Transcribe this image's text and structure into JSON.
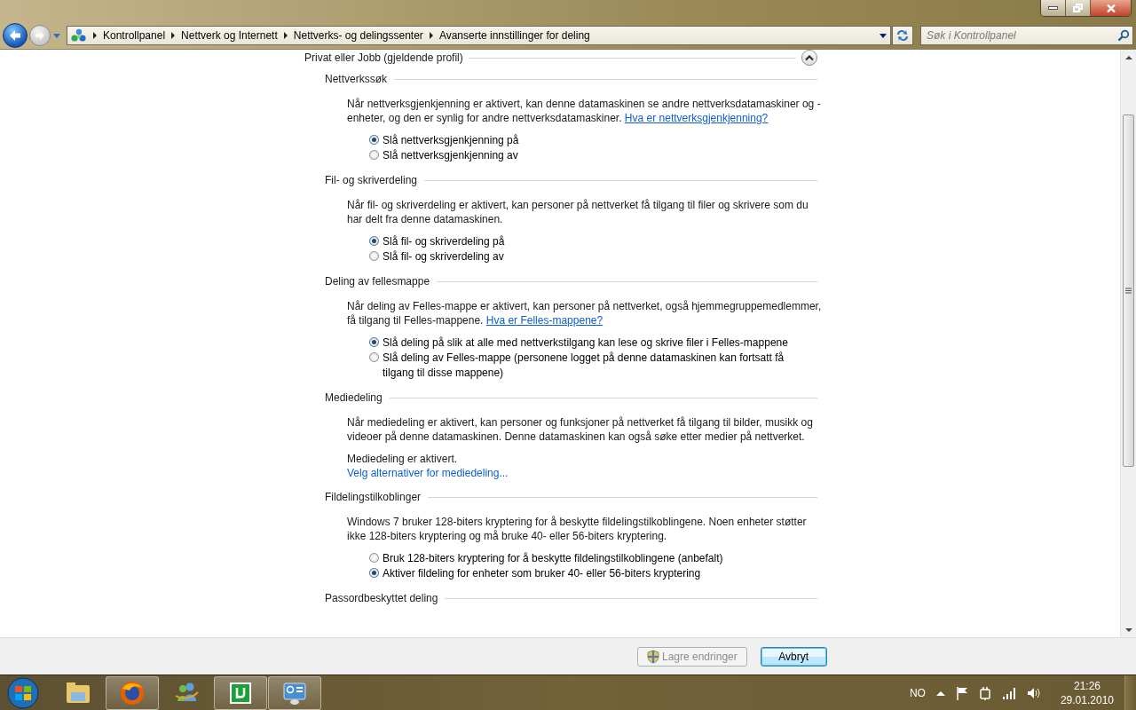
{
  "navigation": {
    "back": {
      "disabled": false
    },
    "forward": {
      "disabled": true
    }
  },
  "address_bar": {
    "breadcrumbs": [
      "Kontrollpanel",
      "Nettverk og Internett",
      "Nettverks- og delingssenter",
      "Avanserte innstillinger for deling"
    ]
  },
  "search": {
    "placeholder": "Søk i Kontrollpanel"
  },
  "profile": {
    "title": "Privat eller Jobb (gjeldende profil)",
    "expanded": true
  },
  "sections": [
    {
      "heading": "Nettverkssøk",
      "description": "Når nettverksgjenkjenning er aktivert, kan denne datamaskinen se andre nettverksdatamaskiner og -enheter, og den er synlig for andre nettverksdatamaskiner.",
      "link": "Hva er nettverksgjenkjenning?",
      "items": [
        {
          "kind": "radio",
          "label": "Slå nettverksgjenkjenning på",
          "selected": true
        },
        {
          "kind": "radio",
          "label": "Slå nettverksgjenkjenning av",
          "selected": false
        }
      ]
    },
    {
      "heading": "Fil- og skriverdeling",
      "description": "Når fil- og skriverdeling er aktivert, kan personer på nettverket få tilgang til filer og skrivere som du har delt fra denne datamaskinen.",
      "items": [
        {
          "kind": "radio",
          "label": "Slå fil- og skriverdeling på",
          "selected": true
        },
        {
          "kind": "radio",
          "label": "Slå fil- og skriverdeling av",
          "selected": false
        }
      ]
    },
    {
      "heading": "Deling av fellesmappe",
      "description": "Når deling av Felles-mappe er aktivert, kan personer på nettverket, også hjemmegruppemedlemmer, få tilgang til Felles-mappene.",
      "link": "Hva er Felles-mappene?",
      "items": [
        {
          "kind": "radio",
          "label": "Slå deling på slik at alle med nettverkstilgang kan lese og skrive filer i Felles-mappene",
          "selected": true
        },
        {
          "kind": "radio",
          "label": "Slå deling av Felles-mappe (personene logget på denne datamaskinen kan fortsatt få tilgang til disse mappene)",
          "selected": false
        }
      ]
    },
    {
      "heading": "Mediedeling",
      "description": "Når mediedeling er aktivert, kan personer og funksjoner på nettverket få tilgang til bilder, musikk og videoer på denne datamaskinen. Denne datamaskinen kan også søke etter medier på nettverket.",
      "items": [
        {
          "kind": "status",
          "label": "Mediedeling er aktivert."
        },
        {
          "kind": "link",
          "label": "Velg alternativer for mediedeling..."
        }
      ]
    },
    {
      "heading": "Fildelingstilkoblinger",
      "description": "Windows 7 bruker 128-biters kryptering for å beskytte fildelingstilkoblingene. Noen enheter støtter ikke 128-biters kryptering og må bruke 40- eller 56-biters kryptering.",
      "items": [
        {
          "kind": "radio",
          "label": "Bruk 128-biters kryptering for å beskytte fildelingstilkoblingene (anbefalt)",
          "selected": false
        },
        {
          "kind": "radio",
          "label": "Aktiver fildeling for enheter som bruker 40- eller 56-biters kryptering",
          "selected": true
        }
      ]
    },
    {
      "heading": "Passordbeskyttet deling"
    }
  ],
  "buttons": [
    {
      "label": "Lagre endringer",
      "disabled": true,
      "shield": true
    },
    {
      "label": "Avbryt",
      "disabled": false,
      "shield": false
    }
  ],
  "taskbar": {
    "apps": [
      {
        "kind": "folder",
        "active": false
      },
      {
        "kind": "firefox",
        "active": true
      },
      {
        "kind": "messenger",
        "active": false
      },
      {
        "kind": "torrent",
        "active": true
      },
      {
        "kind": "control-panel",
        "active": true
      }
    ],
    "language": "NO",
    "time": "21:26",
    "date": "29.01.2010"
  }
}
